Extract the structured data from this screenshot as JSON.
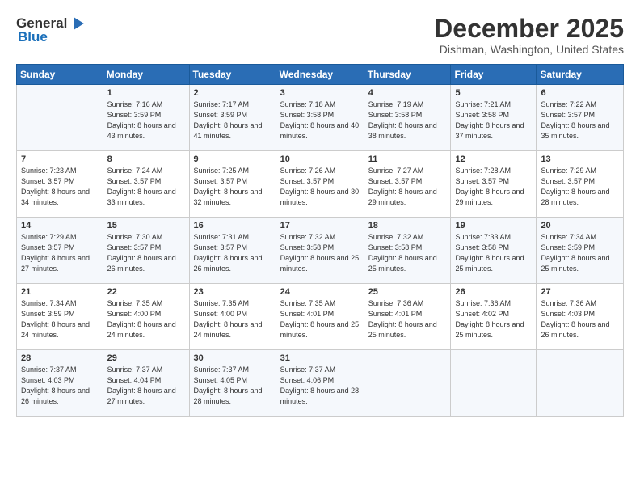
{
  "logo": {
    "general": "General",
    "blue": "Blue"
  },
  "header": {
    "month": "December 2025",
    "location": "Dishman, Washington, United States"
  },
  "days_of_week": [
    "Sunday",
    "Monday",
    "Tuesday",
    "Wednesday",
    "Thursday",
    "Friday",
    "Saturday"
  ],
  "weeks": [
    [
      {
        "day": "",
        "sunrise": "",
        "sunset": "",
        "daylight": ""
      },
      {
        "day": "1",
        "sunrise": "Sunrise: 7:16 AM",
        "sunset": "Sunset: 3:59 PM",
        "daylight": "Daylight: 8 hours and 43 minutes."
      },
      {
        "day": "2",
        "sunrise": "Sunrise: 7:17 AM",
        "sunset": "Sunset: 3:59 PM",
        "daylight": "Daylight: 8 hours and 41 minutes."
      },
      {
        "day": "3",
        "sunrise": "Sunrise: 7:18 AM",
        "sunset": "Sunset: 3:58 PM",
        "daylight": "Daylight: 8 hours and 40 minutes."
      },
      {
        "day": "4",
        "sunrise": "Sunrise: 7:19 AM",
        "sunset": "Sunset: 3:58 PM",
        "daylight": "Daylight: 8 hours and 38 minutes."
      },
      {
        "day": "5",
        "sunrise": "Sunrise: 7:21 AM",
        "sunset": "Sunset: 3:58 PM",
        "daylight": "Daylight: 8 hours and 37 minutes."
      },
      {
        "day": "6",
        "sunrise": "Sunrise: 7:22 AM",
        "sunset": "Sunset: 3:57 PM",
        "daylight": "Daylight: 8 hours and 35 minutes."
      }
    ],
    [
      {
        "day": "7",
        "sunrise": "Sunrise: 7:23 AM",
        "sunset": "Sunset: 3:57 PM",
        "daylight": "Daylight: 8 hours and 34 minutes."
      },
      {
        "day": "8",
        "sunrise": "Sunrise: 7:24 AM",
        "sunset": "Sunset: 3:57 PM",
        "daylight": "Daylight: 8 hours and 33 minutes."
      },
      {
        "day": "9",
        "sunrise": "Sunrise: 7:25 AM",
        "sunset": "Sunset: 3:57 PM",
        "daylight": "Daylight: 8 hours and 32 minutes."
      },
      {
        "day": "10",
        "sunrise": "Sunrise: 7:26 AM",
        "sunset": "Sunset: 3:57 PM",
        "daylight": "Daylight: 8 hours and 30 minutes."
      },
      {
        "day": "11",
        "sunrise": "Sunrise: 7:27 AM",
        "sunset": "Sunset: 3:57 PM",
        "daylight": "Daylight: 8 hours and 29 minutes."
      },
      {
        "day": "12",
        "sunrise": "Sunrise: 7:28 AM",
        "sunset": "Sunset: 3:57 PM",
        "daylight": "Daylight: 8 hours and 29 minutes."
      },
      {
        "day": "13",
        "sunrise": "Sunrise: 7:29 AM",
        "sunset": "Sunset: 3:57 PM",
        "daylight": "Daylight: 8 hours and 28 minutes."
      }
    ],
    [
      {
        "day": "14",
        "sunrise": "Sunrise: 7:29 AM",
        "sunset": "Sunset: 3:57 PM",
        "daylight": "Daylight: 8 hours and 27 minutes."
      },
      {
        "day": "15",
        "sunrise": "Sunrise: 7:30 AM",
        "sunset": "Sunset: 3:57 PM",
        "daylight": "Daylight: 8 hours and 26 minutes."
      },
      {
        "day": "16",
        "sunrise": "Sunrise: 7:31 AM",
        "sunset": "Sunset: 3:57 PM",
        "daylight": "Daylight: 8 hours and 26 minutes."
      },
      {
        "day": "17",
        "sunrise": "Sunrise: 7:32 AM",
        "sunset": "Sunset: 3:58 PM",
        "daylight": "Daylight: 8 hours and 25 minutes."
      },
      {
        "day": "18",
        "sunrise": "Sunrise: 7:32 AM",
        "sunset": "Sunset: 3:58 PM",
        "daylight": "Daylight: 8 hours and 25 minutes."
      },
      {
        "day": "19",
        "sunrise": "Sunrise: 7:33 AM",
        "sunset": "Sunset: 3:58 PM",
        "daylight": "Daylight: 8 hours and 25 minutes."
      },
      {
        "day": "20",
        "sunrise": "Sunrise: 7:34 AM",
        "sunset": "Sunset: 3:59 PM",
        "daylight": "Daylight: 8 hours and 25 minutes."
      }
    ],
    [
      {
        "day": "21",
        "sunrise": "Sunrise: 7:34 AM",
        "sunset": "Sunset: 3:59 PM",
        "daylight": "Daylight: 8 hours and 24 minutes."
      },
      {
        "day": "22",
        "sunrise": "Sunrise: 7:35 AM",
        "sunset": "Sunset: 4:00 PM",
        "daylight": "Daylight: 8 hours and 24 minutes."
      },
      {
        "day": "23",
        "sunrise": "Sunrise: 7:35 AM",
        "sunset": "Sunset: 4:00 PM",
        "daylight": "Daylight: 8 hours and 24 minutes."
      },
      {
        "day": "24",
        "sunrise": "Sunrise: 7:35 AM",
        "sunset": "Sunset: 4:01 PM",
        "daylight": "Daylight: 8 hours and 25 minutes."
      },
      {
        "day": "25",
        "sunrise": "Sunrise: 7:36 AM",
        "sunset": "Sunset: 4:01 PM",
        "daylight": "Daylight: 8 hours and 25 minutes."
      },
      {
        "day": "26",
        "sunrise": "Sunrise: 7:36 AM",
        "sunset": "Sunset: 4:02 PM",
        "daylight": "Daylight: 8 hours and 25 minutes."
      },
      {
        "day": "27",
        "sunrise": "Sunrise: 7:36 AM",
        "sunset": "Sunset: 4:03 PM",
        "daylight": "Daylight: 8 hours and 26 minutes."
      }
    ],
    [
      {
        "day": "28",
        "sunrise": "Sunrise: 7:37 AM",
        "sunset": "Sunset: 4:03 PM",
        "daylight": "Daylight: 8 hours and 26 minutes."
      },
      {
        "day": "29",
        "sunrise": "Sunrise: 7:37 AM",
        "sunset": "Sunset: 4:04 PM",
        "daylight": "Daylight: 8 hours and 27 minutes."
      },
      {
        "day": "30",
        "sunrise": "Sunrise: 7:37 AM",
        "sunset": "Sunset: 4:05 PM",
        "daylight": "Daylight: 8 hours and 28 minutes."
      },
      {
        "day": "31",
        "sunrise": "Sunrise: 7:37 AM",
        "sunset": "Sunset: 4:06 PM",
        "daylight": "Daylight: 8 hours and 28 minutes."
      },
      {
        "day": "",
        "sunrise": "",
        "sunset": "",
        "daylight": ""
      },
      {
        "day": "",
        "sunrise": "",
        "sunset": "",
        "daylight": ""
      },
      {
        "day": "",
        "sunrise": "",
        "sunset": "",
        "daylight": ""
      }
    ]
  ]
}
